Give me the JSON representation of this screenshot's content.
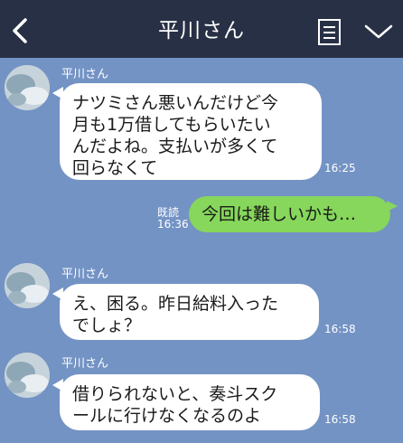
{
  "header": {
    "title": "平川さん",
    "icons": [
      "back-arrow-icon",
      "notes-icon",
      "chevron-down-icon"
    ]
  },
  "messages": [
    {
      "sender": "平川さん",
      "text": "ナツミさん悪いんだけど今\n月も1万借してもらいたい\nんだよね。支払いが多くて\n回らなくて",
      "time": "16:25"
    },
    {
      "outgoing": true,
      "read": "既読",
      "text": "今回は難しいかも…",
      "time": "16:36"
    },
    {
      "sender": "平川さん",
      "text": "え、困る。昨日給料入った\nでしょ？",
      "time": "16:58"
    },
    {
      "sender": "平川さん",
      "text": "借りられないと、奏斗スク\nールに行けなくなるのよ",
      "time": "16:58"
    }
  ],
  "colors": {
    "background": "#7393c4",
    "header": "#283045",
    "outgoing_bubble": "#86d75b",
    "incoming_bubble": "#ffffff"
  }
}
